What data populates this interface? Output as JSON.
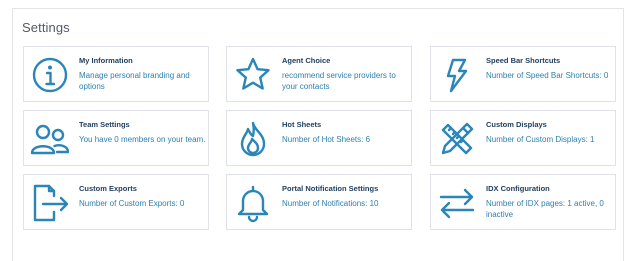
{
  "page": {
    "title": "Settings"
  },
  "colors": {
    "accent": "#2a86b8",
    "title_text": "#21405e",
    "desc_text": "#2f7fae",
    "border": "#dfe3e8"
  },
  "cards": [
    {
      "icon": "info-icon",
      "title": "My Information",
      "description": "Manage personal branding and options"
    },
    {
      "icon": "star-icon",
      "title": "Agent Choice",
      "description": "recommend service providers to your contacts"
    },
    {
      "icon": "lightning-icon",
      "title": "Speed Bar Shortcuts",
      "description": "Number of Speed Bar Shortcuts: 0"
    },
    {
      "icon": "team-icon",
      "title": "Team Settings",
      "description": "You have 0 members on your team."
    },
    {
      "icon": "flame-icon",
      "title": "Hot Sheets",
      "description": "Number of Hot Sheets: 6"
    },
    {
      "icon": "pencil-ruler-icon",
      "title": "Custom Displays",
      "description": "Number of Custom Displays: 1"
    },
    {
      "icon": "export-icon",
      "title": "Custom Exports",
      "description": "Number of Custom Exports: 0"
    },
    {
      "icon": "bell-icon",
      "title": "Portal Notification Settings",
      "description": "Number of Notifications: 10"
    },
    {
      "icon": "arrows-exchange-icon",
      "title": "IDX Configuration",
      "description": "Number of IDX pages: 1 active, 0 inactive"
    }
  ]
}
